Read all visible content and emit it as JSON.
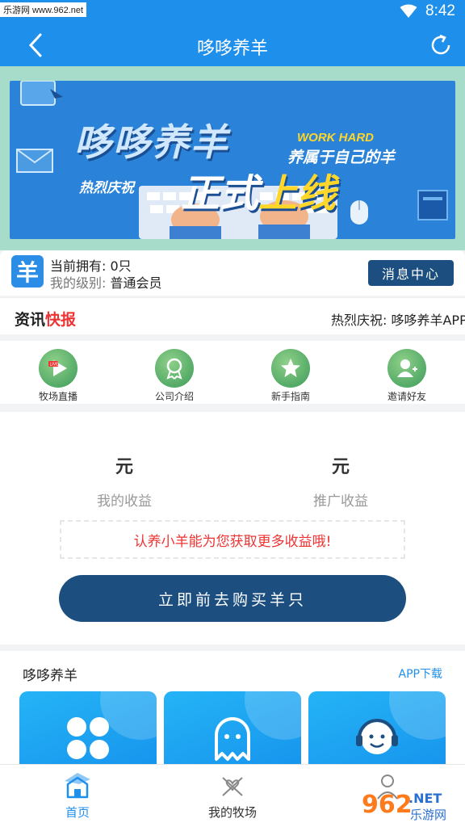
{
  "status_bar": {
    "watermark": "乐游网 www.962.net",
    "time": "8:42"
  },
  "app_bar": {
    "title": "哆哆养羊"
  },
  "banner": {
    "title": "哆哆养羊",
    "work_hard": "WORK HARD",
    "subtitle": "养属于自己的羊",
    "celebrate": "热烈庆祝",
    "online_a": "正式",
    "online_b": "上线"
  },
  "member": {
    "logo_char": "羊",
    "owned_label": "当前拥有:",
    "owned_value": "0只",
    "level_label": "我的级别:",
    "level_value": "普通会员",
    "message_button": "消息中心"
  },
  "news": {
    "label_a": "资讯",
    "label_b": "快报",
    "ticker": "热烈庆祝: 哆哆养羊APP"
  },
  "quick_menu": [
    {
      "label": "牧场直播",
      "icon": "live-play-icon"
    },
    {
      "label": "公司介绍",
      "icon": "award-ribbon-icon"
    },
    {
      "label": "新手指南",
      "icon": "star-icon"
    },
    {
      "label": "邀请好友",
      "icon": "add-user-icon"
    }
  ],
  "earnings": {
    "my_value": "元",
    "my_label": "我的收益",
    "promo_value": "元",
    "promo_label": "推广收益",
    "tip": "认养小羊能为您获取更多收益哦!",
    "buy_button": "立即前去购买羊只"
  },
  "section": {
    "title": "哆哆养羊",
    "link": "APP下载",
    "cards": [
      {
        "icon": "clover-grid-icon"
      },
      {
        "icon": "ghost-icon"
      },
      {
        "icon": "headset-support-icon"
      }
    ]
  },
  "bottom_nav": [
    {
      "label": "首页",
      "icon": "home-icon",
      "active": true
    },
    {
      "label": "我的牧场",
      "icon": "ranch-icon",
      "active": false
    },
    {
      "label": "",
      "icon": "user-icon",
      "active": false
    }
  ],
  "watermark_br": {
    "number": "962",
    "suffix": ".NET",
    "cn": "乐游网"
  },
  "colors": {
    "primary": "#1f8fec",
    "dark_button": "#1c4f80",
    "highlight": "#e33333",
    "banner_yellow": "#ffd62a"
  }
}
